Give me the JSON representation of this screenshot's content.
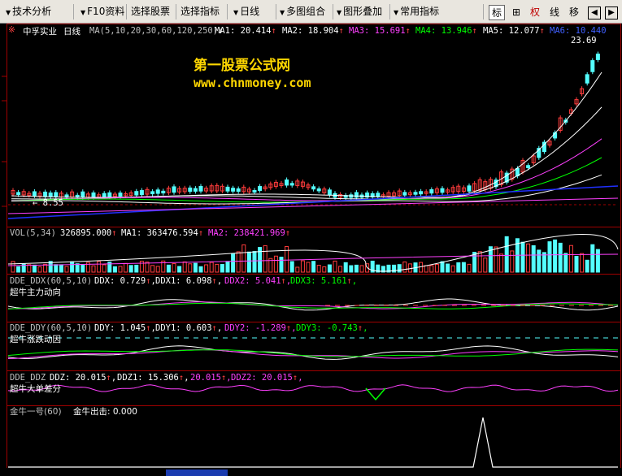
{
  "toolbar": {
    "menus": [
      {
        "label": "技术分析"
      },
      {
        "label": "F10资料"
      },
      {
        "label": "选择股票"
      },
      {
        "label": "选择指标"
      },
      {
        "label": "日线"
      },
      {
        "label": "多图组合"
      },
      {
        "label": "图形叠加"
      },
      {
        "label": "常用指标"
      }
    ],
    "right_buttons": [
      {
        "label": "标",
        "active": true
      },
      {
        "label": "⊞",
        "active": false
      },
      {
        "label": "权",
        "active": false,
        "red": true
      },
      {
        "label": "线",
        "active": false
      },
      {
        "label": "移",
        "active": false
      },
      {
        "label": "◀",
        "active": false
      },
      {
        "label": "▶",
        "active": false
      }
    ]
  },
  "main_chart": {
    "stock_name": "中孚实业",
    "period": "日线",
    "ma_header": "MA(5,10,20,30,60,120,250)",
    "ma_values": [
      {
        "name": "MA1",
        "value": "20.414",
        "color": "#ffffff"
      },
      {
        "name": "MA2",
        "value": "18.904",
        "color": "#ffffff"
      },
      {
        "name": "MA3",
        "value": "15.691",
        "color": "#ff40ff"
      },
      {
        "name": "MA4",
        "value": "13.946",
        "color": "#00ff00"
      },
      {
        "name": "MA5",
        "value": "12.077",
        "color": "#ffffff"
      },
      {
        "name": "MA6",
        "value": "10.440",
        "color": "#4060ff"
      }
    ],
    "high_label": "23.69",
    "low_label": "8.55",
    "watermark_cn": "第一股票公式网",
    "watermark_url": "www.chnmoney.com"
  },
  "vol_panel": {
    "header": "VOL(5,34)",
    "value": "326895.000",
    "ma1": "MA1: 363476.594",
    "ma2": "MA2: 238421.969"
  },
  "ddx_panel": {
    "header": "DDE_DDX(60,5,10)",
    "values": [
      {
        "text": "DDX: 0.729",
        "color": "#ffffff"
      },
      {
        "text": "DDX1: 6.098",
        "color": "#ffffff"
      },
      {
        "text": "DDX2: 5.041",
        "color": "#ff40ff"
      },
      {
        "text": "DDX3: 5.161",
        "color": "#00ff00"
      }
    ],
    "subtitle": "超牛主力动向"
  },
  "ddy_panel": {
    "header": "DDE_DDY(60,5,10)",
    "values": [
      {
        "text": "DDY: 1.045",
        "color": "#ffffff"
      },
      {
        "text": "DDY1: 0.603",
        "color": "#ffffff"
      },
      {
        "text": "DDY2: -1.289",
        "color": "#ff40ff"
      },
      {
        "text": "DDY3: -0.743",
        "color": "#00ff00"
      }
    ],
    "subtitle": "超牛涨跌动因"
  },
  "ddz_panel": {
    "header": "DDE_DDZ",
    "values": [
      {
        "text": "DDZ: 20.015",
        "color": "#ffffff"
      },
      {
        "text": "DDZ1: 15.306",
        "color": "#ffffff"
      },
      {
        "text": "20.015",
        "color": "#ff40ff"
      },
      {
        "text": "DDZ2: 20.015",
        "color": "#ff40ff"
      }
    ],
    "subtitle": "超牛大单差分"
  },
  "jinniu_panel": {
    "header": "金牛一号(60)",
    "value": "金牛出击: 0.000"
  },
  "colors": {
    "axis": "#a00000",
    "up": "#ff3c3c",
    "down": "#54ffff",
    "ma_white": "#ffffff",
    "ma_magenta": "#ff40ff",
    "ma_green": "#00ff00",
    "ma_blue": "#2030ff",
    "ma_yellow": "#ffff00"
  }
}
